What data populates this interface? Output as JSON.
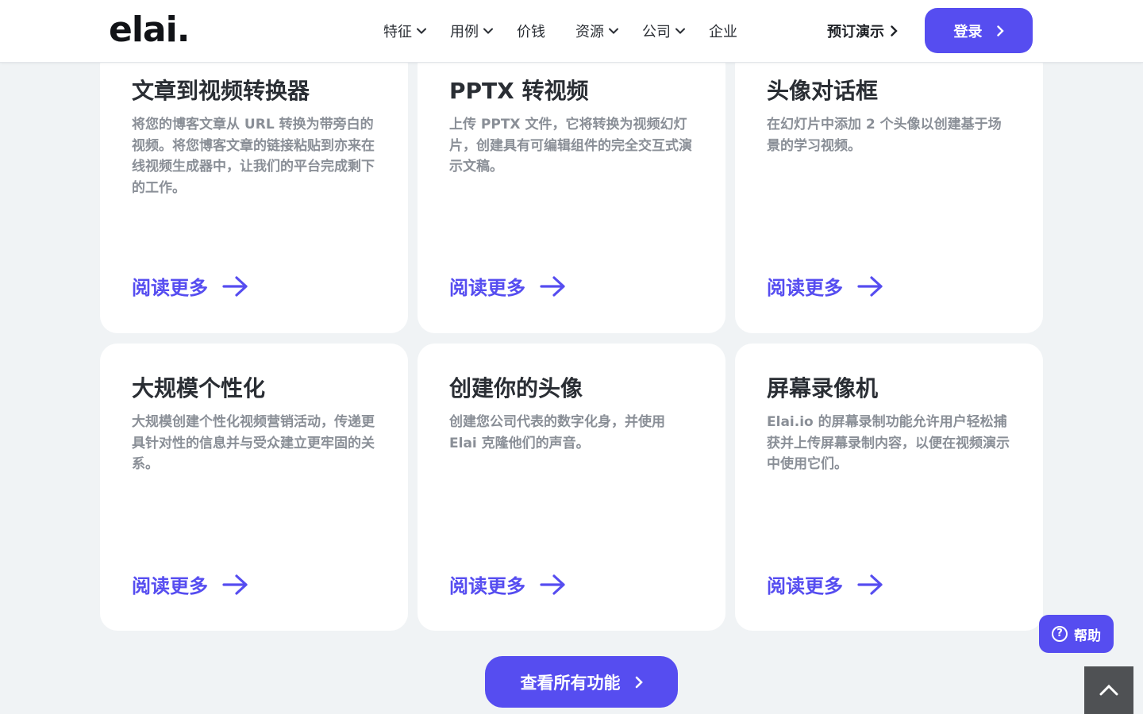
{
  "header": {
    "logo": "elai.",
    "nav": [
      {
        "label": "特征",
        "has_dropdown": true
      },
      {
        "label": "用例",
        "has_dropdown": true
      },
      {
        "label": "价钱",
        "has_dropdown": false
      },
      {
        "label": "资源",
        "has_dropdown": true
      },
      {
        "label": "公司",
        "has_dropdown": true
      },
      {
        "label": "企业",
        "has_dropdown": false
      }
    ],
    "demo_label": "预订演示",
    "login_label": "登录"
  },
  "cards": [
    {
      "title": "文章到视频转换器",
      "description": "将您的博客文章从 URL 转换为带旁白的视频。将您博客文章的链接粘贴到亦来在线视频生成器中，让我们的平台完成剩下的工作。",
      "more": "阅读更多"
    },
    {
      "title": "PPTX 转视频",
      "description": "上传 PPTX 文件，它将转换为视频幻灯片，创建具有可编辑组件的完全交互式演示文稿。",
      "more": "阅读更多"
    },
    {
      "title": "头像对话框",
      "description": "在幻灯片中添加 2 个头像以创建基于场景的学习视频。",
      "more": "阅读更多"
    },
    {
      "title": "大规模个性化",
      "description": "大规模创建个性化视频营销活动，传递更具针对性的信息并与受众建立更牢固的关系。",
      "more": "阅读更多"
    },
    {
      "title": "创建你的头像",
      "description": "创建您公司代表的数字化身，并使用 Elai 克隆他们的声音。",
      "more": "阅读更多"
    },
    {
      "title": "屏幕录像机",
      "description": "Elai.io 的屏幕录制功能允许用户轻松捕获并上传屏幕录制内容，以便在视频演示中使用它们。",
      "more": "阅读更多"
    }
  ],
  "help_label": "帮助",
  "view_all_label": "查看所有功能",
  "colors": {
    "accent": "#564df0",
    "background": "#f0f3f5",
    "card": "#ffffff"
  }
}
